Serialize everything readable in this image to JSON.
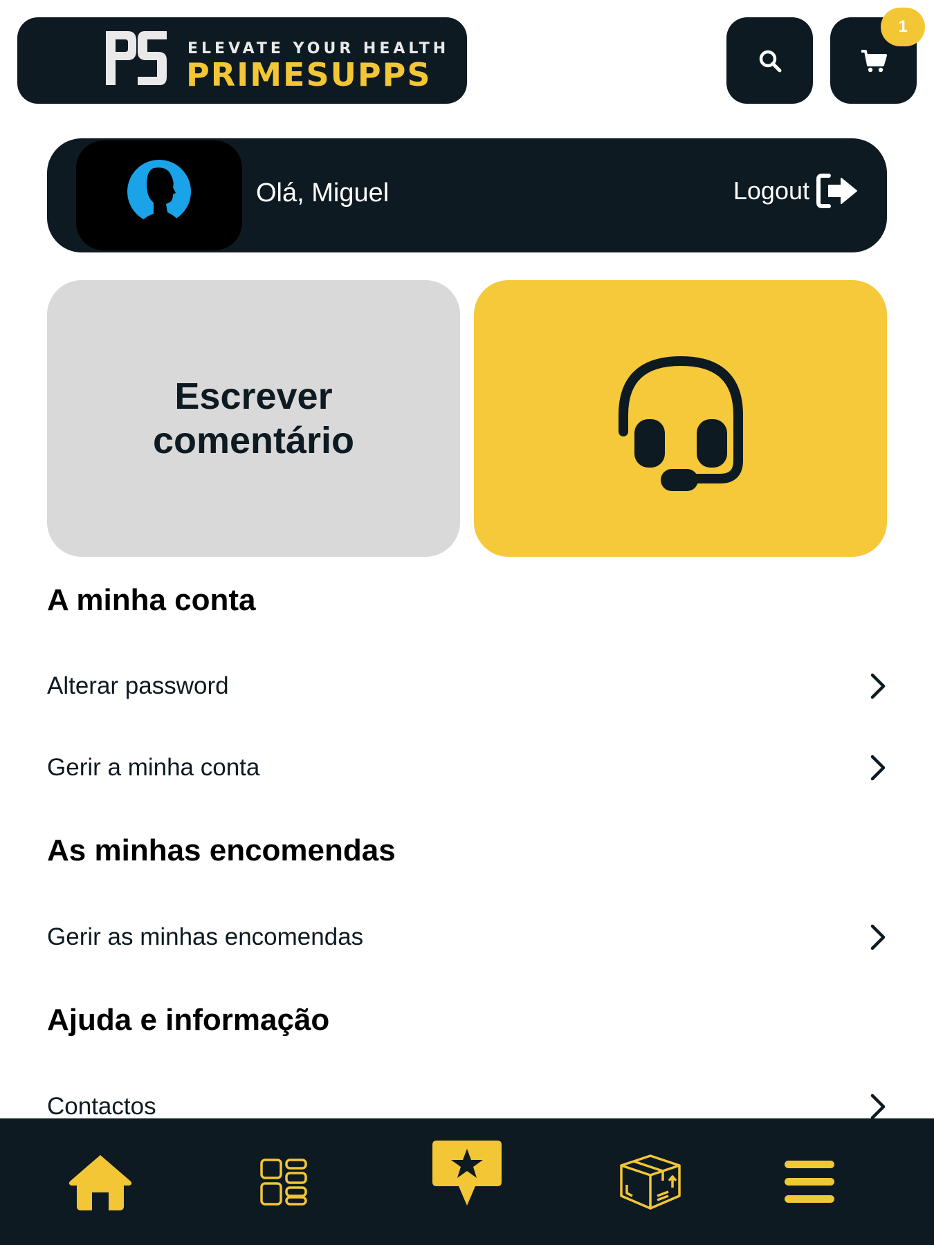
{
  "header": {
    "logo": {
      "monogram": "PS",
      "tagline": "ELEVATE YOUR HEALTH",
      "brand_part1": "PRIME",
      "brand_part2": "SUPPS"
    },
    "search_icon": "search-icon",
    "cart_icon": "cart-icon",
    "cart_count": "1"
  },
  "user_bar": {
    "greeting": "Olá, Miguel",
    "logout_label": "Logout"
  },
  "tiles": {
    "review_label": "Escrever comentário",
    "support_icon": "headset-icon"
  },
  "sections": [
    {
      "title": "A minha conta",
      "items": [
        {
          "label": "Alterar password"
        },
        {
          "label": "Gerir a minha conta"
        }
      ]
    },
    {
      "title": "As minhas encomendas",
      "items": [
        {
          "label": "Gerir as minhas encomendas"
        }
      ]
    },
    {
      "title": "Ajuda e informação",
      "items": [
        {
          "label": "Contactos"
        }
      ]
    }
  ],
  "bottom_nav": [
    "home-icon",
    "catalog-icon",
    "reviews-icon",
    "orders-box-icon",
    "menu-icon"
  ],
  "colors": {
    "dark": "#0d1a22",
    "accent": "#f5c939",
    "tile_grey": "#d9d9d9"
  }
}
